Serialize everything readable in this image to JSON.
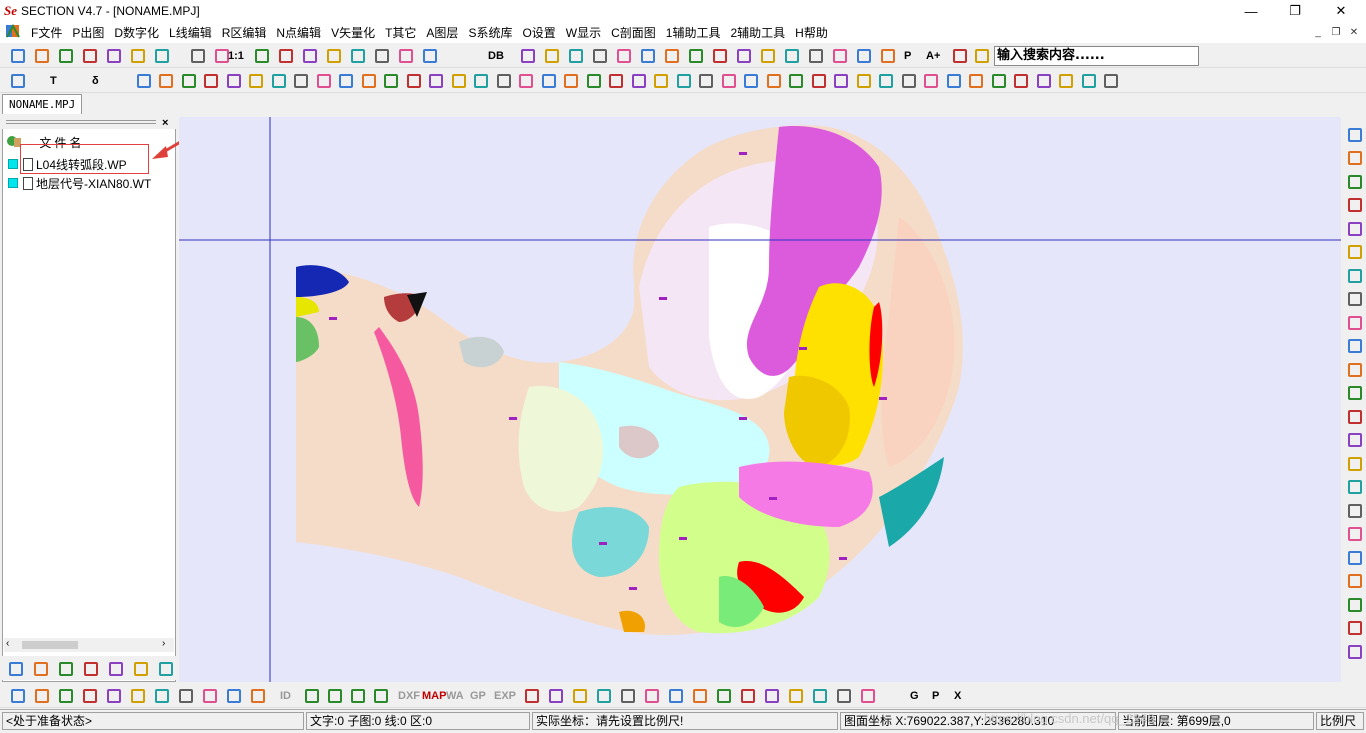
{
  "window": {
    "logo": "Se",
    "title": "SECTION V4.7 - [NONAME.MPJ]",
    "controls": {
      "minimize": "—",
      "restore": "❐",
      "close": "✕"
    }
  },
  "menu": {
    "items": [
      "F文件",
      "P出图",
      "D数字化",
      "L线编辑",
      "R区编辑",
      "N点编辑",
      "V矢量化",
      "T其它",
      "A图层",
      "S系统库",
      "O设置",
      "W显示",
      "C剖面图",
      "1辅助工具",
      "2辅助工具",
      "H帮助"
    ]
  },
  "toolbar1": {
    "zoom_label": "1:1",
    "db_label": "DB",
    "p_label": "P",
    "aplus_label": "A+",
    "search_value": "输入搜索内容......"
  },
  "toolbar2": {
    "text_tool": "T",
    "delta_tool": "δ"
  },
  "doc_tab": "NONAME.MPJ",
  "file_panel": {
    "header": "文件名",
    "files": [
      "L04线转弧段.WP",
      "地层代号-XIAN80.WT"
    ]
  },
  "bottom_toolbar": {
    "labels": [
      "ID",
      "DXF",
      "MAP",
      "WA",
      "GP",
      "EXP",
      "G",
      "P",
      "X"
    ]
  },
  "status": {
    "state": "<处于准备状态>",
    "counts": "文字:0 子图:0 线:0 区:0",
    "real_coords": "实际坐标：请先设置比例尺!",
    "map_coords": "图面坐标 X:769022.387,Y:2936280.310",
    "layer": "当前图层: 第699层,0",
    "scale": "比例尺"
  },
  "watermark": "https://blog.csdn.net/qq_2249",
  "colors": {
    "canvas_bg": "#e6e6fa",
    "crosshair": "#3030c0",
    "annotation_arrow": "#e0403a",
    "layer_square": "#00e5ee"
  }
}
